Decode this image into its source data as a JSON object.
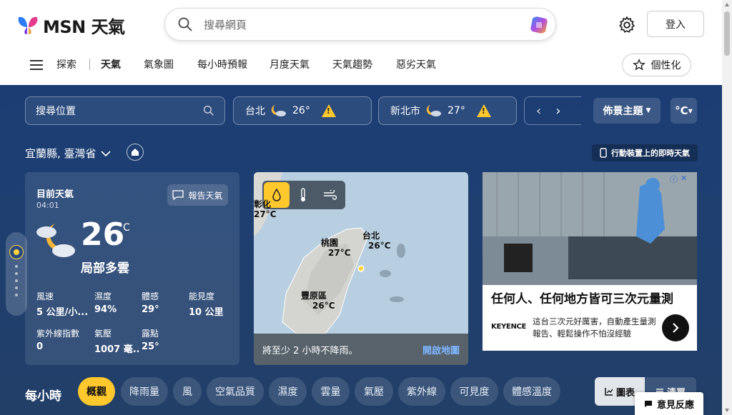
{
  "header": {
    "logo_text": "MSN 天氣",
    "search_placeholder": "搜尋網頁",
    "login_label": "登入",
    "personalize_label": "個性化"
  },
  "nav": {
    "items": [
      "探索",
      "天氣",
      "氣象圖",
      "每小時預報",
      "月度天氣",
      "天氣趨勢",
      "惡劣天氣"
    ],
    "active": "天氣"
  },
  "toolbar": {
    "location_search_placeholder": "搜尋位置",
    "cities": [
      {
        "name": "台北",
        "temp": "26°"
      },
      {
        "name": "新北市",
        "temp": "27°"
      }
    ],
    "theme_label": "佈景主題",
    "unit_label": "°C"
  },
  "location": {
    "region": "宜蘭縣, 臺灣省",
    "mobile_label": "行動裝置上的即時天氣"
  },
  "current": {
    "title": "目前天氣",
    "time": "04:01",
    "report_label": "報告天氣",
    "temp": "26",
    "unit": "°C",
    "condition": "局部多雲",
    "stats": [
      {
        "label": "風速",
        "value": "5 公里/小..."
      },
      {
        "label": "濕度",
        "value": "94%"
      },
      {
        "label": "體感",
        "value": "29°"
      },
      {
        "label": "能見度",
        "value": "10 公里"
      },
      {
        "label": "紫外線指數",
        "value": "0"
      },
      {
        "label": "氣壓",
        "value": "1007 毫..."
      },
      {
        "label": "露點",
        "value": "25°"
      }
    ]
  },
  "map": {
    "labels": [
      {
        "name": "彰化",
        "temp": "27°C"
      },
      {
        "name": "桃園",
        "temp": "27°C"
      },
      {
        "name": "台北",
        "temp": "26°C"
      },
      {
        "name": "豐原區",
        "temp": "26°C"
      }
    ],
    "precip_note": "將至少 2 小時不降雨。",
    "open_map_label": "開啟地圖"
  },
  "ad": {
    "headline": "任何人、任何地方皆可三次元量測",
    "brand": "KEYENCE",
    "description": "這台三次元好厲害，自動產生量測報告、輕鬆操作不怕沒經驗"
  },
  "hourly": {
    "title": "每小時",
    "chips": [
      "概觀",
      "降雨量",
      "風",
      "空氣品質",
      "濕度",
      "雲量",
      "氣壓",
      "紫外線",
      "可見度",
      "體感溫度"
    ],
    "active": "概觀",
    "view_chart": "圖表",
    "view_list": "清單"
  },
  "feedback_label": "意見反應",
  "colors": {
    "accent": "#ffc82c",
    "bg": "#1e3f70"
  }
}
